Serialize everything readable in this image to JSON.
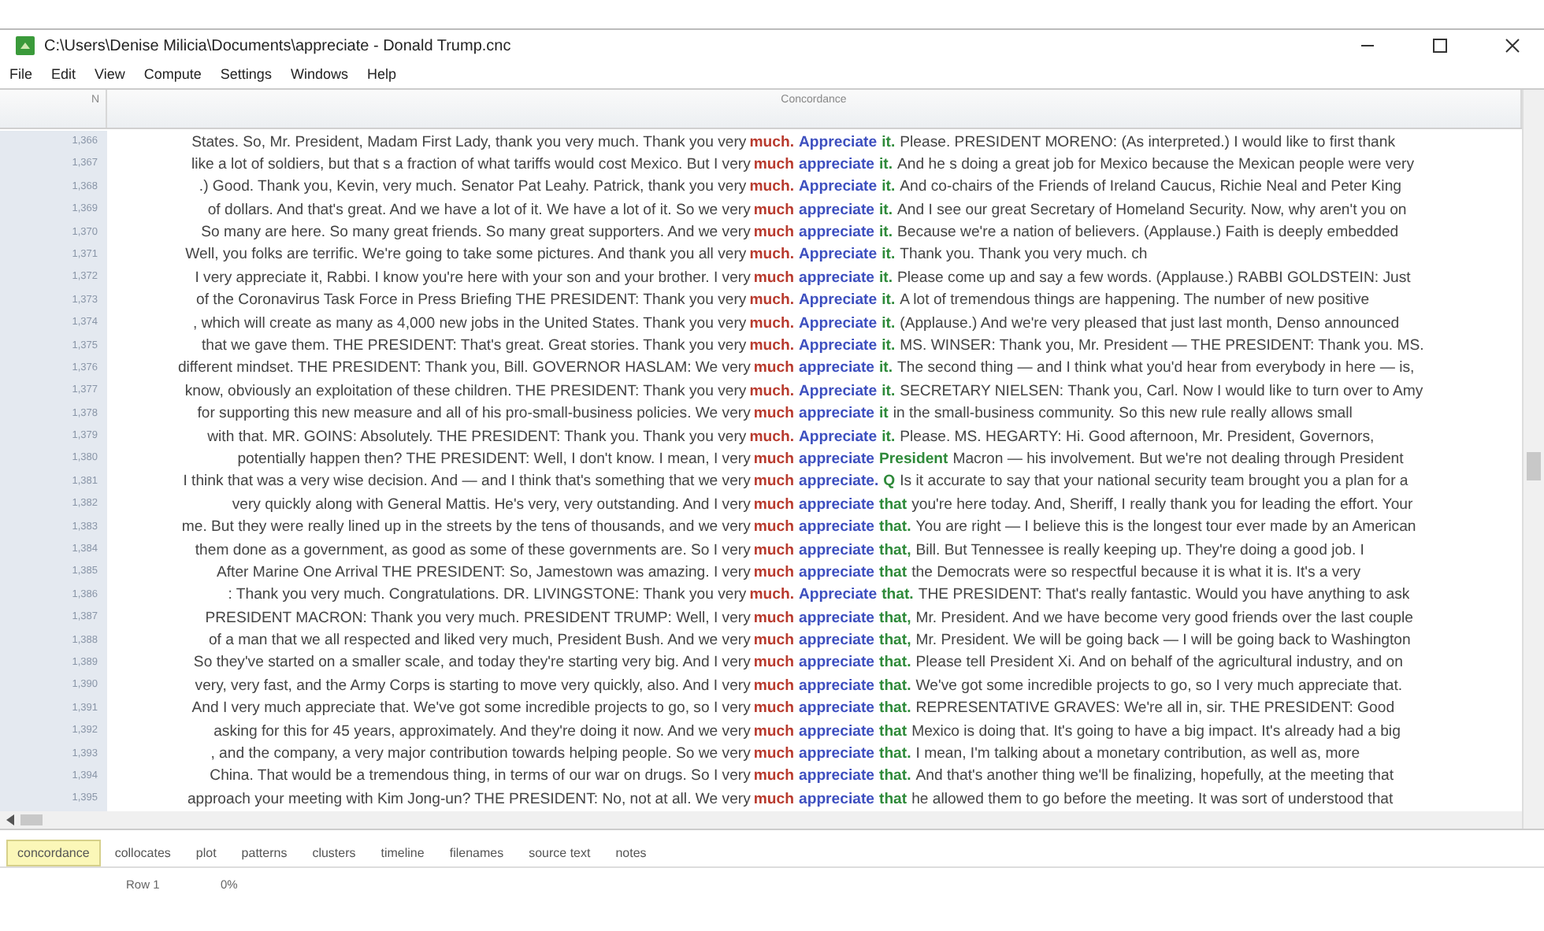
{
  "window": {
    "title": "C:\\Users\\Denise Milicia\\Documents\\appreciate - Donald Trump.cnc"
  },
  "menu": [
    "File",
    "Edit",
    "View",
    "Compute",
    "Settings",
    "Windows",
    "Help"
  ],
  "table": {
    "columns": [
      "N",
      "Concordance"
    ],
    "rows": [
      {
        "n": "1,366",
        "left": "States. So, Mr. President, Madam First Lady, thank you very much.  Thank you very",
        "hit_1": "much.",
        "hit_2": "Appreciate",
        "hit_3": "it.",
        "right": "Please. PRESIDENT MORENO:  (As interpreted.) I would like to first thank"
      },
      {
        "n": "1,367",
        "left": "like a lot of soldiers, but that s a fraction of what tariffs would cost Mexico. But I very",
        "hit_1": "much",
        "hit_2": "appreciate",
        "hit_3": "it.",
        "right": "And he s doing a great job for Mexico because the Mexican people were very"
      },
      {
        "n": "1,368",
        "left": ".) Good. Thank you, Kevin, very much. Senator Pat Leahy. Patrick, thank you very",
        "hit_1": "much.",
        "hit_2": "Appreciate",
        "hit_3": "it.",
        "right": "And co-chairs of the Friends of Ireland Caucus, Richie Neal and Peter King"
      },
      {
        "n": "1,369",
        "left": "of dollars.  And that's great.  And we have a lot of it.  We have a lot of it.  So we very",
        "hit_1": "much",
        "hit_2": "appreciate",
        "hit_3": "it.",
        "right": "And I see our great Secretary of Homeland Security.  Now, why aren't you on"
      },
      {
        "n": "1,370",
        "left": "So many are here.  So many great friends.  So many great supporters.  And we very",
        "hit_1": "much",
        "hit_2": "appreciate",
        "hit_3": "it.",
        "right": "Because we're a nation of believers.  (Applause.)  Faith is deeply embedded"
      },
      {
        "n": "1,371",
        "left": "Well, you folks are terrific. We're going to take some pictures. And thank you all very",
        "hit_1": "much.",
        "hit_2": "Appreciate",
        "hit_3": "it.",
        "right": "Thank you. Thank you very much. ch"
      },
      {
        "n": "1,372",
        "left": "I very appreciate it, Rabbi.  I know you're here with your son and your brother.  I very",
        "hit_1": "much",
        "hit_2": "appreciate",
        "hit_3": "it.",
        "right": "Please come up and say a few words.  (Applause.) RABBI GOLDSTEIN:  Just"
      },
      {
        "n": "1,373",
        "left": "of the Coronavirus Task Force in Press Briefing THE PRESIDENT:  Thank you very",
        "hit_1": "much.",
        "hit_2": "Appreciate",
        "hit_3": "it.",
        "right": "A lot of tremendous things are happening.  The number of new positive"
      },
      {
        "n": "1,374",
        "left": ", which will create as many as 4,000 new jobs in the United States. Thank you very",
        "hit_1": "much.",
        "hit_2": "Appreciate",
        "hit_3": "it.",
        "right": "(Applause.) And we're very pleased that just last month, Denso announced"
      },
      {
        "n": "1,375",
        "left": "that we gave them. THE PRESIDENT:  That's great.  Great stories.  Thank you very",
        "hit_1": "much.",
        "hit_2": "Appreciate",
        "hit_3": "it.",
        "right": "MS. WINSER:  Thank you, Mr. President — THE PRESIDENT:  Thank you. MS."
      },
      {
        "n": "1,376",
        "left": "different mindset. THE PRESIDENT:  Thank you, Bill. GOVERNOR HASLAM:  We very",
        "hit_1": "much",
        "hit_2": "appreciate",
        "hit_3": "it.",
        "right": "The second thing — and I think what you'd hear from everybody in here — is,"
      },
      {
        "n": "1,377",
        "left": "know, obviously an exploitation of these children. THE PRESIDENT:  Thank you very",
        "hit_1": "much.",
        "hit_2": "Appreciate",
        "hit_3": "it.",
        "right": "SECRETARY NIELSEN:  Thank you, Carl. Now I would like to turn over to Amy"
      },
      {
        "n": "1,378",
        "left": "for supporting this new measure and all of his pro-small-business policies.  We very",
        "hit_1": "much",
        "hit_2": "appreciate",
        "hit_3": "it",
        "right": "in the small-business community. So this new rule really allows small"
      },
      {
        "n": "1,379",
        "left": "with that. MR. GOINS: Absolutely. THE PRESIDENT: Thank you. Thank you very",
        "hit_1": "much.",
        "hit_2": "Appreciate",
        "hit_3": "it.",
        "right": "Please. MS. HEGARTY: Hi. Good afternoon, Mr. President, Governors,"
      },
      {
        "n": "1,380",
        "left": "potentially happen then? THE PRESIDENT:  Well, I don't know.  I mean, I very",
        "hit_1": "much",
        "hit_2": "appreciate",
        "hit_3": "President",
        "right": "Macron — his involvement.  But we're not dealing through President"
      },
      {
        "n": "1,381",
        "left": "I think that was a very wise decision.  And — and I think that's something that we very",
        "hit_1": "much",
        "hit_2": "appreciate.",
        "hit_3": "Q",
        "right": "Is it accurate to say that your national security team brought you a plan for a"
      },
      {
        "n": "1,382",
        "left": "very quickly along with General Mattis. He's very, very outstanding. And I very",
        "hit_1": "much",
        "hit_2": "appreciate",
        "hit_3": "that",
        "right": "you're here today. And, Sheriff, I really thank you for leading the effort. Your"
      },
      {
        "n": "1,383",
        "left": "me.  But they were really lined up in the streets by the tens of thousands, and we very",
        "hit_1": "much",
        "hit_2": "appreciate",
        "hit_3": "that.",
        "right": "You are right — I believe this is the longest tour ever made by an American"
      },
      {
        "n": "1,384",
        "left": "them done as a government, as good as some of these governments are. So I very",
        "hit_1": "much",
        "hit_2": "appreciate",
        "hit_3": "that,",
        "right": "Bill.  But Tennessee is really keeping up.  They're doing a good job.  I"
      },
      {
        "n": "1,385",
        "left": "After Marine One Arrival THE PRESIDENT:  So, Jamestown was amazing.  I very",
        "hit_1": "much",
        "hit_2": "appreciate",
        "hit_3": "that",
        "right": "the Democrats were so respectful because it is what it is.  It's a very"
      },
      {
        "n": "1,386",
        "left": ": Thank you very much.  Congratulations. DR. LIVINGSTONE:  Thank you very",
        "hit_1": "much.",
        "hit_2": "Appreciate",
        "hit_3": "that.",
        "right": "THE PRESIDENT:  That's really fantastic. Would you have anything to ask"
      },
      {
        "n": "1,387",
        "left": "PRESIDENT MACRON:  Thank you very much. PRESIDENT TRUMP:  Well, I very",
        "hit_1": "much",
        "hit_2": "appreciate",
        "hit_3": "that,",
        "right": "Mr. President.  And we have become very good friends over the last couple"
      },
      {
        "n": "1,388",
        "left": "of a man that we all respected and liked very much, President Bush.  And we very",
        "hit_1": "much",
        "hit_2": "appreciate",
        "hit_3": "that,",
        "right": "Mr. President. We will be going back — I will be going back to Washington"
      },
      {
        "n": "1,389",
        "left": "So they've started on a smaller scale, and today they're starting very big.  And I very",
        "hit_1": "much",
        "hit_2": "appreciate",
        "hit_3": "that.",
        "right": "Please tell President Xi.  And on behalf of the agricultural industry, and on"
      },
      {
        "n": "1,390",
        "left": "very, very fast, and the Army Corps is starting to move very quickly, also.  And I very",
        "hit_1": "much",
        "hit_2": "appreciate",
        "hit_3": "that.",
        "right": "We've got some incredible projects to go, so I very much appreciate that."
      },
      {
        "n": "1,391",
        "left": "And I very much appreciate that.  We've got some incredible projects to go, so I very",
        "hit_1": "much",
        "hit_2": "appreciate",
        "hit_3": "that.",
        "right": "REPRESENTATIVE GRAVES:  We're all in, sir. THE PRESIDENT:  Good"
      },
      {
        "n": "1,392",
        "left": "asking for this for 45 years, approximately.  And they're doing it now.  And we very",
        "hit_1": "much",
        "hit_2": "appreciate",
        "hit_3": "that",
        "right": "Mexico is doing that.  It's going to have a big impact.  It's already had a big"
      },
      {
        "n": "1,393",
        "left": ", and the company, a very major contribution towards helping people.  So we very",
        "hit_1": "much",
        "hit_2": "appreciate",
        "hit_3": "that.",
        "right": "I mean, I'm talking about a monetary contribution, as well as, more"
      },
      {
        "n": "1,394",
        "left": "China.  That would be a tremendous thing, in terms of our war on drugs. So I very",
        "hit_1": "much",
        "hit_2": "appreciate",
        "hit_3": "that.",
        "right": "And that's another thing we'll be finalizing, hopefully, at the meeting that"
      },
      {
        "n": "1,395",
        "left": "approach your meeting with Kim Jong-un? THE PRESIDENT:  No, not at all.  We very",
        "hit_1": "much",
        "hit_2": "appreciate",
        "hit_3": "that",
        "right": "he allowed them to go before the meeting.  It was sort of understood that"
      }
    ]
  },
  "tabs": [
    {
      "label": "concordance",
      "selected": true
    },
    {
      "label": "collocates",
      "selected": false
    },
    {
      "label": "plot",
      "selected": false
    },
    {
      "label": "patterns",
      "selected": false
    },
    {
      "label": "clusters",
      "selected": false
    },
    {
      "label": "timeline",
      "selected": false
    },
    {
      "label": "filenames",
      "selected": false
    },
    {
      "label": "source text",
      "selected": false
    },
    {
      "label": "notes",
      "selected": false
    }
  ],
  "status_bar": [
    "Row 1",
    "0%"
  ]
}
